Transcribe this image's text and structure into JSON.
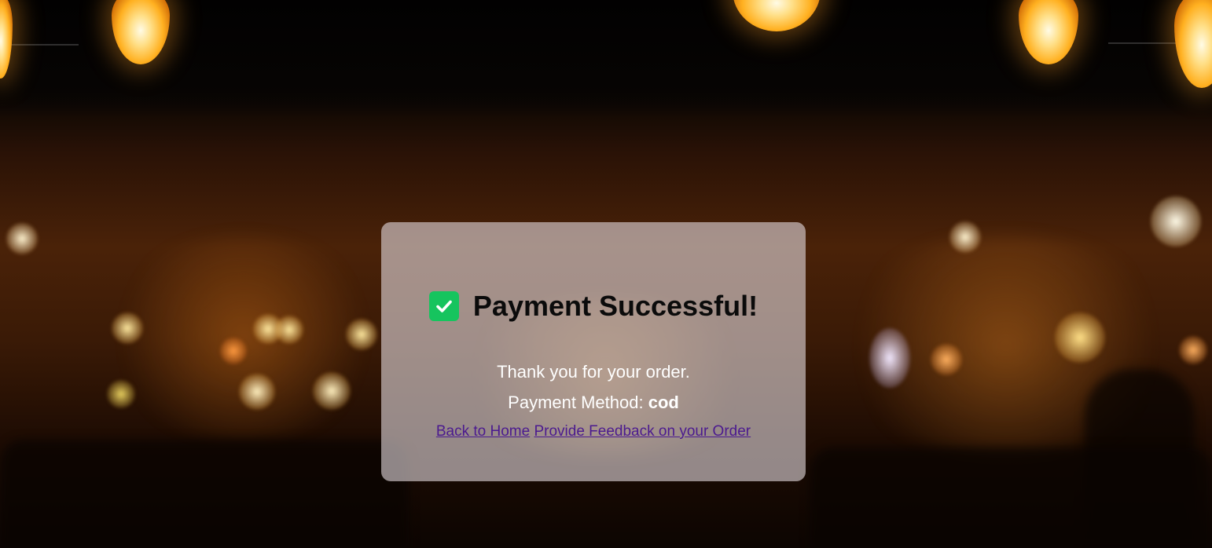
{
  "confirmation": {
    "title": "Payment Successful!",
    "icon": "check-icon",
    "thank_you": "Thank you for your order.",
    "payment_method_label": "Payment Method: ",
    "payment_method_value": "cod"
  },
  "links": {
    "home": "Back to Home",
    "feedback": "Provide Feedback on your Order"
  },
  "colors": {
    "success": "#16c45e",
    "link": "#4b1a8f",
    "card_background": "rgba(225,215,218,0.62)"
  }
}
